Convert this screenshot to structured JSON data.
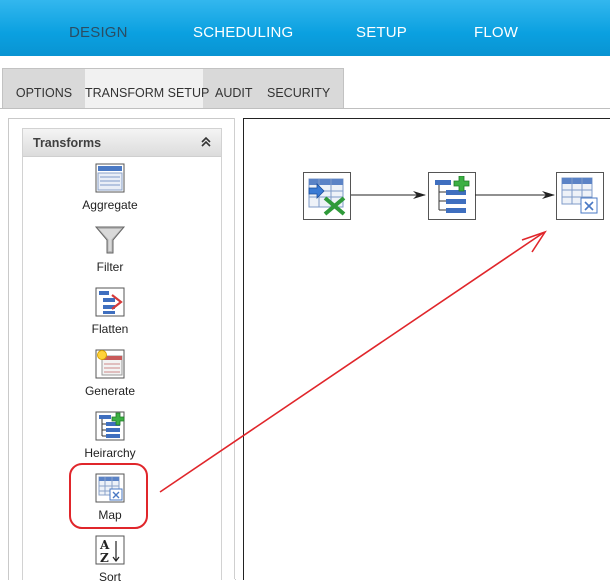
{
  "nav": {
    "items": [
      "DESIGN",
      "SCHEDULING",
      "SETUP",
      "FLOW"
    ],
    "active_index": 0
  },
  "tabs": [
    "OPTIONS",
    "TRANSFORM SETUP",
    "AUDIT",
    "SECURITY"
  ],
  "tabs_active_index": 1,
  "transforms": {
    "title": "Transforms",
    "items": [
      {
        "label": "Aggregate",
        "icon": "aggregate-icon"
      },
      {
        "label": "Filter",
        "icon": "filter-icon"
      },
      {
        "label": "Flatten",
        "icon": "flatten-icon"
      },
      {
        "label": "Generate",
        "icon": "generate-icon"
      },
      {
        "label": "Heirarchy",
        "icon": "hierarchy-icon"
      },
      {
        "label": "Map",
        "icon": "map-icon"
      },
      {
        "label": "Sort",
        "icon": "sort-icon"
      }
    ]
  },
  "canvas": {
    "nodes": [
      {
        "icon": "excel-source-icon"
      },
      {
        "icon": "hierarchy-icon"
      },
      {
        "icon": "map-icon"
      }
    ]
  },
  "colors": {
    "nav_bg": "#0aa0e0",
    "annotation": "#e0262b"
  }
}
